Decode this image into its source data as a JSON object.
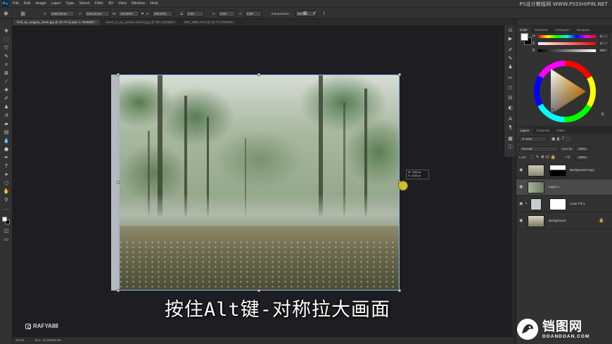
{
  "app": {
    "logo": "Ps"
  },
  "menu": [
    "File",
    "Edit",
    "Image",
    "Layer",
    "Type",
    "Select",
    "Filter",
    "3D",
    "View",
    "Window",
    "Help"
  ],
  "top_watermark": "PS设计教程网 WWW.PSSSHIPIN.NET",
  "options": {
    "x_label": "X:",
    "x_value": "1040,50 px",
    "y_label": "Y:",
    "y_value": "1116,50 px",
    "w_label": "W:",
    "w_value": "120,00%",
    "h_label": "H:",
    "h_value": "100,00%",
    "angle_value": "0,00",
    "hskew_label": "H:",
    "hskew_value": "0,00",
    "vskew_label": "V:",
    "vskew_value": "0,00",
    "interp_label": "Interpolation:",
    "interp_value": "Bicubic",
    "cancel_icon": "cancel-transform-icon",
    "commit_icon": "commit-transform-icon"
  },
  "tabs": [
    "field_by_wagary_stock.jpg @ 33,7% (Layer 1, RGB/8#) *",
    "forest_bi_by_andrea (stock).jpg @ 25% (RGB/8*)",
    "IMG_9951.JPG @ 16,7% (RGB/8*)"
  ],
  "transform_tooltip": {
    "w": "W : 2900 px",
    "h": "H : 2220 px"
  },
  "subtitle": "按住Alt键-对称拉大画面",
  "instagram": "RAFYA88",
  "status": {
    "zoom": "33,3%",
    "doc": "Doc: 19,2M/39,9M"
  },
  "color_panel": {
    "tabs": [
      "Color",
      "Swatches",
      "Histogram",
      "Navigator"
    ],
    "active_tab": 0,
    "sliders": [
      {
        "label": "H",
        "value": "0",
        "gradient": "linear-gradient(90deg,#ff0000,#ffff00,#00ff00,#00ffff,#0000ff,#ff00ff,#ff0000)"
      },
      {
        "label": "S",
        "value": "0",
        "gradient": "linear-gradient(90deg,#ffffff,#ff0000)"
      },
      {
        "label": "B",
        "value": "100",
        "gradient": "linear-gradient(90deg,#000000,#ffffff)"
      }
    ],
    "fg_color": "#ffffff",
    "bg_color": "#000000"
  },
  "layers_panel": {
    "tabs": [
      "Layers",
      "Channels",
      "Paths"
    ],
    "active_tab": 0,
    "kind_placeholder": "Kind",
    "blend_mode": "Normal",
    "opacity_label": "Opacity:",
    "opacity_value": "100%",
    "lock_label": "Lock:",
    "fill_label": "Fill:",
    "fill_value": "100%",
    "layers": [
      {
        "name": "Background copy",
        "selected": false,
        "has_mask": true,
        "locked": false
      },
      {
        "name": "Layer 1",
        "selected": true,
        "has_mask": false,
        "locked": false
      },
      {
        "name": "Color Fill 1",
        "selected": false,
        "has_mask": true,
        "locked": false
      },
      {
        "name": "Background",
        "selected": false,
        "has_mask": false,
        "locked": true
      }
    ]
  },
  "logo": {
    "cn": "铛图网",
    "en": "DOANDOAN.COM"
  }
}
